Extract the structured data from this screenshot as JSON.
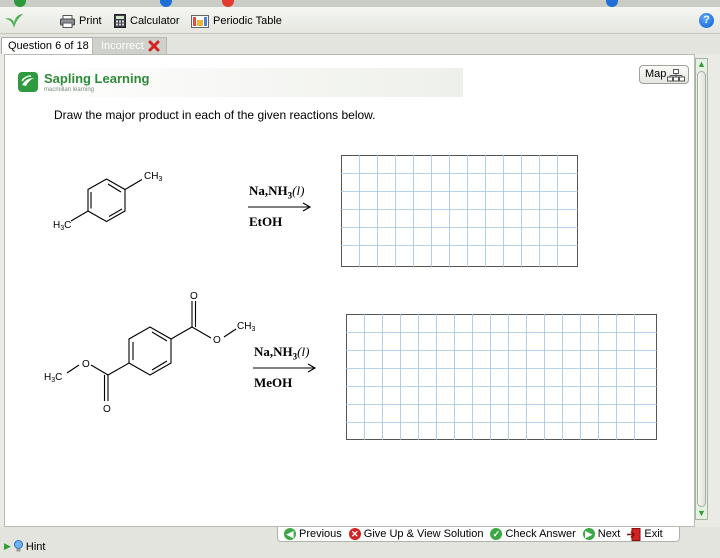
{
  "toolbar": {
    "print_label": "Print",
    "calculator_label": "Calculator",
    "periodic_label": "Periodic Table",
    "help_label": "?"
  },
  "tabs": {
    "question_label": "Question 6 of 18",
    "status_label": "Incorrect"
  },
  "header": {
    "brand_name": "Sapling Learning",
    "brand_sub": "macmillan learning",
    "map_label": "Map"
  },
  "question": {
    "instruction": "Draw the major product in each of the given reactions below."
  },
  "reaction1": {
    "substituent_top": "CH3",
    "substituent_bottom": "H3C",
    "reagent_main": "Na,NH",
    "reagent_sub": "3",
    "reagent_state": "(l)",
    "solvent": "EtOH"
  },
  "reaction2": {
    "carbonyl_top_o": "O",
    "ester_top_o": "O",
    "ester_top_ch3": "CH3",
    "carbonyl_bottom_o": "O",
    "ester_bottom_o": "O",
    "ester_bottom_ch3": "H3C",
    "reagent_main": "Na,NH",
    "reagent_sub": "3",
    "reagent_state": "(l)",
    "solvent": "MeOH"
  },
  "bottom": {
    "hint_label": "Hint",
    "previous_label": "Previous",
    "giveup_label": "Give Up & View Solution",
    "check_label": "Check Answer",
    "next_label": "Next",
    "exit_label": "Exit"
  },
  "colors": {
    "brand_green": "#2d8a39",
    "grid_line": "#9ec4e6",
    "error_red": "#d22222"
  }
}
